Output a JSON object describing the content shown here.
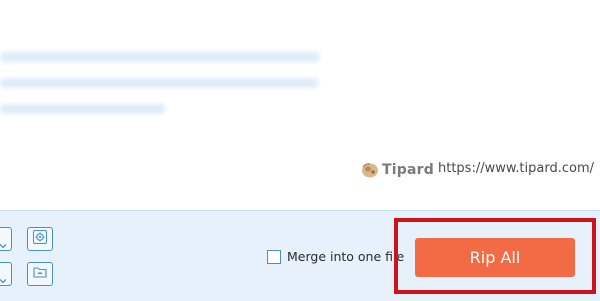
{
  "brand": {
    "name": "Tipard",
    "url": "https://www.tipard.com/"
  },
  "merge": {
    "label": "Merge into one file",
    "checked": false
  },
  "rip_button": {
    "label": "Rip All"
  },
  "icons": {
    "settings": "gear-icon",
    "output_folder": "folder-icon",
    "dropdown": "chevron-down-icon",
    "logo": "tipard-logo-icon"
  },
  "colors": {
    "rip_button": "#f26b44",
    "highlight": "#d0121b",
    "bottom_bar": "#e6f1fc",
    "accent": "#4a90c8"
  }
}
